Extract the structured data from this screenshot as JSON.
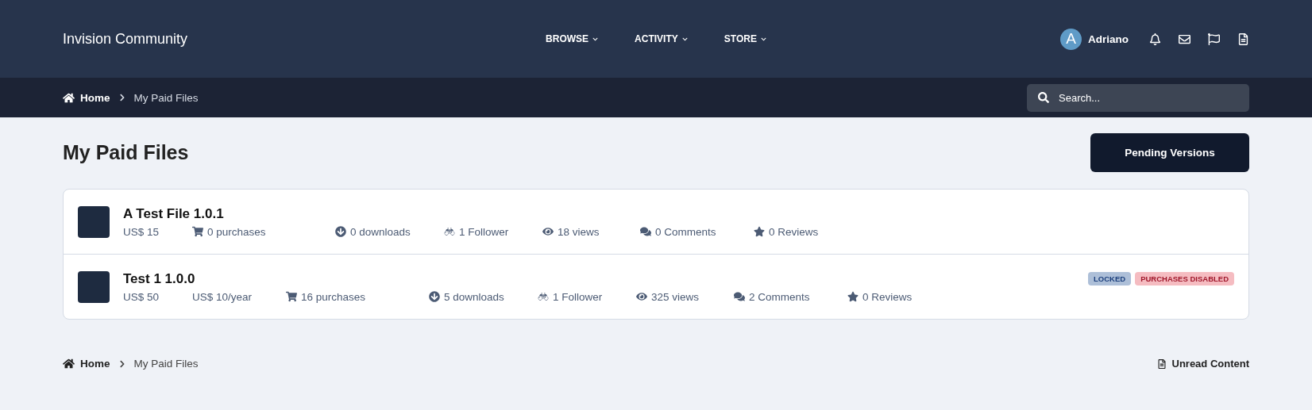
{
  "header": {
    "site_title": "Invision Community",
    "nav": [
      {
        "label": "BROWSE"
      },
      {
        "label": "ACTIVITY"
      },
      {
        "label": "STORE"
      }
    ],
    "user": {
      "avatar_letter": "A",
      "name": "Adriano"
    }
  },
  "breadcrumb": {
    "items": [
      "Home",
      "My Paid Files"
    ]
  },
  "search": {
    "placeholder": "Search..."
  },
  "page": {
    "title": "My Paid Files",
    "action_button": "Pending Versions"
  },
  "files": [
    {
      "title": "A Test File 1.0.1",
      "stats": [
        {
          "kind": "price",
          "text": "US$ 15"
        },
        {
          "kind": "purchases",
          "text": "0 purchases"
        },
        {
          "kind": "downloads",
          "text": "0 downloads"
        },
        {
          "kind": "followers",
          "text": "1 Follower"
        },
        {
          "kind": "views",
          "text": "18 views"
        },
        {
          "kind": "comments",
          "text": "0 Comments"
        },
        {
          "kind": "reviews",
          "text": "0 Reviews"
        }
      ]
    },
    {
      "title": "Test 1 1.0.0",
      "stats": [
        {
          "kind": "price",
          "text": "US$ 50"
        },
        {
          "kind": "renewal",
          "text": "US$ 10/year"
        },
        {
          "kind": "purchases",
          "text": "16 purchases"
        },
        {
          "kind": "downloads",
          "text": "5 downloads"
        },
        {
          "kind": "followers",
          "text": "1 Follower"
        },
        {
          "kind": "views",
          "text": "325 views"
        },
        {
          "kind": "comments",
          "text": "2 Comments"
        },
        {
          "kind": "reviews",
          "text": "0 Reviews"
        }
      ],
      "badges": [
        {
          "kind": "locked",
          "text": "LOCKED"
        },
        {
          "kind": "disabled",
          "text": "PURCHASES DISABLED"
        }
      ]
    }
  ],
  "footer": {
    "breadcrumb": [
      "Home",
      "My Paid Files"
    ],
    "link": "Unread Content"
  }
}
